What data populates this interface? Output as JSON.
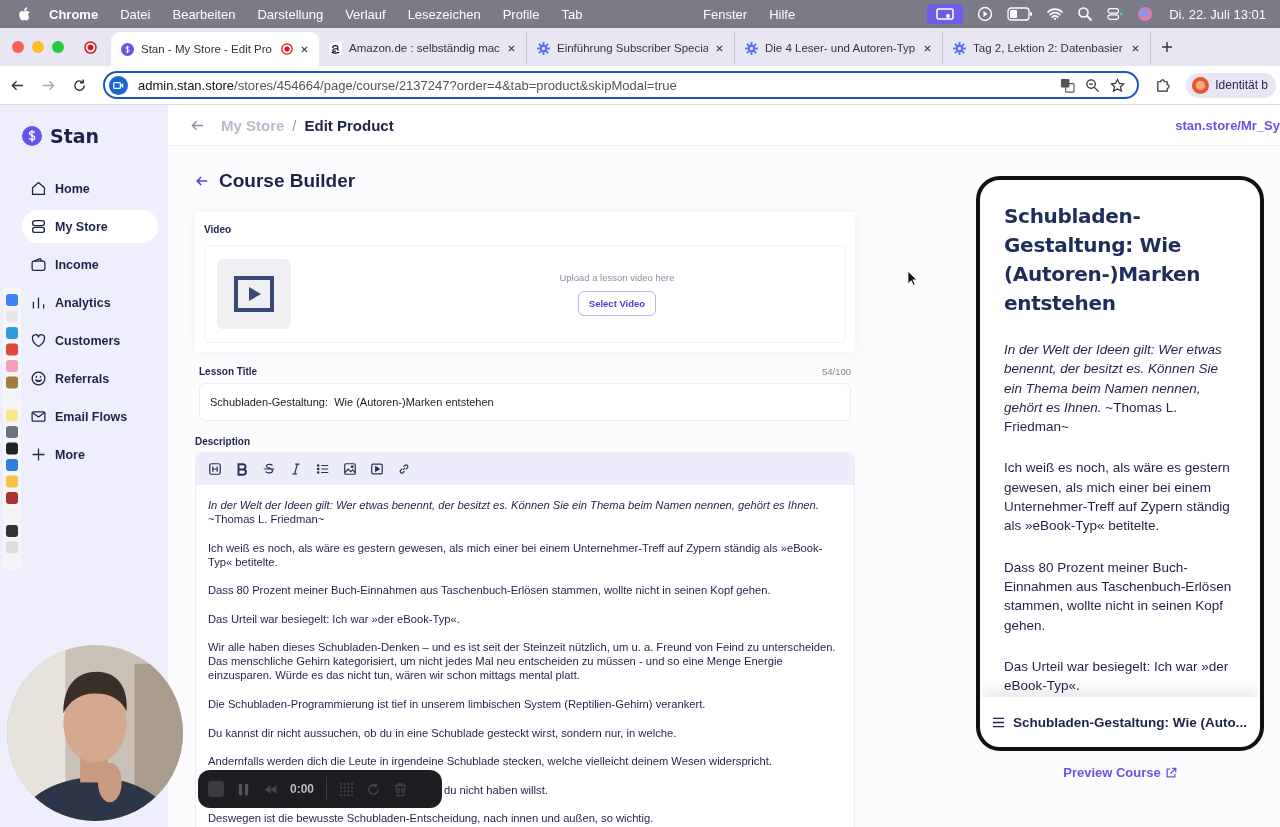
{
  "menu_bar": {
    "app": "Chrome",
    "menus": [
      "Datei",
      "Bearbeiten",
      "Darstellung",
      "Verlauf",
      "Lesezeichen",
      "Profile",
      "Tab"
    ],
    "right_menus": [
      "Fenster",
      "Hilfe"
    ],
    "clock": "Di. 22. Juli  13:01"
  },
  "browser": {
    "tabs": [
      {
        "title": "Stan - My Store - Edit Pro",
        "selected": true
      },
      {
        "title": "Amazon.de : selbständig mac",
        "selected": false
      },
      {
        "title": "Einführung Subscriber Specia",
        "selected": false
      },
      {
        "title": "Die 4 Leser- und Autoren-Typ",
        "selected": false
      },
      {
        "title": "Tag 2, Lektion 2: Datenbasier",
        "selected": false
      }
    ],
    "url_host": "admin.stan.store",
    "url_path": "/stores/454664/page/course/2137247?order=4&tab=product&skipModal=true",
    "profile": "Identität b"
  },
  "sidebar": {
    "brand": "Stan",
    "items": [
      {
        "label": "Home",
        "selected": false
      },
      {
        "label": "My Store",
        "selected": true
      },
      {
        "label": "Income",
        "selected": false
      },
      {
        "label": "Analytics",
        "selected": false
      },
      {
        "label": "Customers",
        "selected": false
      },
      {
        "label": "Referrals",
        "selected": false
      },
      {
        "label": "Email Flows",
        "selected": false
      },
      {
        "label": "More",
        "selected": false
      }
    ]
  },
  "header": {
    "breadcrumb": [
      "My Store",
      "Edit Product"
    ],
    "separator": "/",
    "store_link": "stan.store/Mr_Sy"
  },
  "course_builder": {
    "title": "Course Builder",
    "video": {
      "label": "Video",
      "hint": "Upload a lesson video here",
      "button": "Select Video"
    },
    "lesson_title": {
      "label": "Lesson Title",
      "counter": "54/100",
      "value": "Schubladen-Gestaltung:  Wie (Autoren-)Marken entstehen"
    },
    "description": {
      "label": "Description",
      "paragraphs": [
        "*In der Welt der Ideen gilt: Wer etwas benennt, der besitzt es. Können Sie ein Thema beim Namen nennen, gehört es Ihnen.* ~Thomas L. Friedman~",
        "Ich weiß es noch, als wäre es gestern gewesen, als mich einer bei einem Unternehmer-Treff auf Zypern ständig als »eBook-Typ« betitelte.",
        "Dass 80 Prozent meiner Buch-Einnahmen aus Taschenbuch-Erlösen stammen, wollte nicht in seinen Kopf gehen.",
        "Das Urteil war besiegelt: Ich war »der eBook-Typ«.",
        "Wir alle haben dieses Schubladen-Denken – und es ist seit der Steinzeit nützlich, um u. a. Freund von Feind zu unterscheiden. Das menschliche Gehirn kategorisiert, um nicht jedes Mal neu entscheiden zu müssen - und so eine Menge Energie einzusparen. Würde es das nicht tun, wären wir schon mittags mental platt.",
        "Die Schubladen-Programmierung ist tief in unserem limbischen System (Reptilien-Gehirn) verankert.",
        "Du kannst dir nicht aussuchen, ob du in eine Schublade gesteckt wirst, sondern nur, in welche.",
        "Andernfalls werden dich die Leute in irgendeine Schublade stecken, welche vielleicht deinem Wesen widerspricht.",
        "du nicht haben willst.",
        "Deswegen ist die bewusste Schubladen-Entscheidung, nach innen und außen, so wichtig."
      ]
    }
  },
  "preview": {
    "title": "Schubladen-Gestaltung: Wie (Autoren-)Marken entstehen",
    "paragraphs": [
      "*In der Welt der Ideen gilt: Wer etwas benennt, der besitzt es. Können Sie ein Thema beim Namen nennen, gehört es Ihnen.* ~Thomas L. Friedman~",
      "Ich weiß es noch, als wäre es gestern gewesen, als mich einer bei einem Unternehmer-Treff auf Zypern ständig als »eBook-Typ« betitelte.",
      "Dass 80 Prozent meiner Buch-Einnahmen aus Taschenbuch-Erlösen stammen, wollte nicht in seinen Kopf gehen.",
      "Das Urteil war besiegelt: Ich war »der eBook-Typ«."
    ],
    "nav_title": "Schubladen-Gestaltung: Wie (Auto...",
    "link": "Preview Course"
  },
  "recorder": {
    "time": "0:00"
  }
}
